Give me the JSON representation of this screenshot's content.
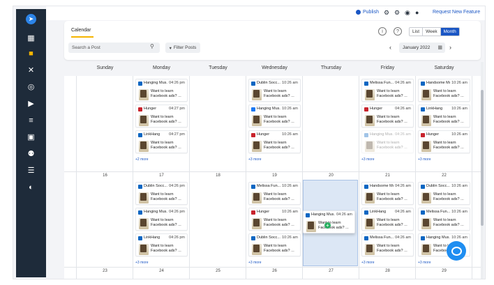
{
  "colors": {
    "accent": "#1a56c4",
    "sidebar_bg": "#1e2b3a",
    "tab_underline": "#f5b400",
    "drop_target": "#dce7f5",
    "add_indicator": "#27ae60"
  },
  "sidebar": {
    "items": [
      {
        "icon": "send-logo-icon"
      },
      {
        "icon": "dashboard-icon"
      },
      {
        "icon": "chat-bubbles-icon"
      },
      {
        "icon": "tools-icon"
      },
      {
        "icon": "target-icon"
      },
      {
        "icon": "megaphone-icon"
      },
      {
        "icon": "analytics-icon"
      },
      {
        "icon": "inbox-icon"
      },
      {
        "icon": "team-icon"
      },
      {
        "icon": "document-icon"
      },
      {
        "icon": "headset-icon"
      }
    ]
  },
  "topbar": {
    "publish_label": "Publish",
    "request_label": "Request New Feature"
  },
  "header": {
    "tab_label": "Calendar",
    "search_placeholder": "Search a Post",
    "filter_label": "Filter Posts",
    "month_label": "January 2022",
    "views": [
      "List",
      "Week",
      "Month"
    ],
    "selected_view": "Month"
  },
  "calendar": {
    "weekdays": [
      "Sunday",
      "Monday",
      "Tuesday",
      "Wednesday",
      "Thursday",
      "Friday",
      "Saturday"
    ],
    "weeks": [
      {
        "days": [
          {
            "num": "",
            "posts": [],
            "more": ""
          },
          {
            "num": "",
            "posts": [
              {
                "network": "linkedin",
                "account": "Hanging Mus...",
                "time": "04:26 pm",
                "line1": "Want to learn",
                "line2": "Facebook ads? ..."
              },
              {
                "network": "pinterest",
                "account": "Hunger",
                "time": "04:27 pm",
                "line1": "Want to learn",
                "line2": "Facebook ads? ..."
              },
              {
                "network": "linkedin",
                "account": "LinkHang",
                "time": "04:27 pm",
                "line1": "Want to learn",
                "line2": "Facebook ads? ..."
              }
            ],
            "more": "+2 more"
          },
          {
            "num": "",
            "posts": [],
            "more": ""
          },
          {
            "num": "",
            "posts": [
              {
                "network": "linkedin",
                "account": "Dublin Socc...",
                "time": "10:26 am",
                "line1": "Want to learn",
                "line2": "Facebook ads? ..."
              },
              {
                "network": "facebook",
                "account": "Hanging Mus...",
                "time": "10:26 am",
                "line1": "Want to learn",
                "line2": "Facebook ads? ..."
              },
              {
                "network": "pinterest",
                "account": "Hunger",
                "time": "10:26 am",
                "line1": "Want to learn",
                "line2": "Facebook ads? ..."
              }
            ],
            "more": "+3 more"
          },
          {
            "num": "",
            "posts": [],
            "more": ""
          },
          {
            "num": "",
            "posts": [
              {
                "network": "linkedin",
                "account": "Melissa Fun...",
                "time": "04:26 am",
                "line1": "Want to learn",
                "line2": "Facebook ads? ..."
              },
              {
                "network": "pinterest",
                "account": "Hunger",
                "time": "04:26 am",
                "line1": "Want to learn",
                "line2": "Facebook ads? ..."
              },
              {
                "network": "linkedin",
                "account": "Hanging Mus...",
                "time": "04:26 am",
                "line1": "Want to learn",
                "line2": "Facebook ads? ...",
                "faded": true
              }
            ],
            "more": "+3 more"
          },
          {
            "num": "",
            "posts": [
              {
                "network": "linkedin",
                "account": "Handsome Mu...",
                "time": "10:26 am",
                "line1": "Want to learn",
                "line2": "Facebook ads? ..."
              },
              {
                "network": "linkedin",
                "account": "LinkHang",
                "time": "10:26 am",
                "line1": "Want to learn",
                "line2": "Facebook ads? ..."
              },
              {
                "network": "pinterest",
                "account": "Hunger",
                "time": "10:26 am",
                "line1": "Want to learn",
                "line2": "Facebook ads? ..."
              }
            ],
            "more": "+3 more"
          }
        ]
      },
      {
        "days": [
          {
            "num": "16",
            "posts": [],
            "more": ""
          },
          {
            "num": "17",
            "posts": [
              {
                "network": "linkedin",
                "account": "Dublin Socc...",
                "time": "04:26 pm",
                "line1": "Want to learn",
                "line2": "Facebook ads? ..."
              },
              {
                "network": "linkedin",
                "account": "Hanging Mus...",
                "time": "04:26 pm",
                "line1": "Want to learn",
                "line2": "Facebook ads? ..."
              },
              {
                "network": "linkedin",
                "account": "LinkHang",
                "time": "04:26 pm",
                "line1": "Want to learn",
                "line2": "Facebook ads? ..."
              }
            ],
            "more": "+3 more"
          },
          {
            "num": "18",
            "posts": [],
            "more": ""
          },
          {
            "num": "19",
            "posts": [
              {
                "network": "linkedin",
                "account": "Melissa Fun...",
                "time": "10:26 am",
                "line1": "Want to learn",
                "line2": "Facebook ads? ..."
              },
              {
                "network": "pinterest",
                "account": "Hunger",
                "time": "10:26 am",
                "line1": "Want to learn",
                "line2": "Facebook ads? ..."
              },
              {
                "network": "linkedin",
                "account": "Dublin Socc...",
                "time": "10:26 am",
                "line1": "Want to learn",
                "line2": "Facebook ads? ..."
              }
            ],
            "more": "+3 more"
          },
          {
            "num": "20",
            "posts": [],
            "more": ""
          },
          {
            "num": "21",
            "posts": [
              {
                "network": "linkedin",
                "account": "Handsome Mu...",
                "time": "04:26 am",
                "line1": "Want to learn",
                "line2": "Facebook ads? ..."
              },
              {
                "network": "linkedin",
                "account": "LinkHang",
                "time": "04:26 am",
                "line1": "Want to learn",
                "line2": "Facebook ads? ..."
              },
              {
                "network": "linkedin",
                "account": "Melissa Fun...",
                "time": "04:26 am",
                "line1": "Want to learn",
                "line2": "Facebook ads? ..."
              }
            ],
            "more": "+3 more"
          },
          {
            "num": "22",
            "posts": [
              {
                "network": "linkedin",
                "account": "Dublin Socc...",
                "time": "10:26 am",
                "line1": "Want to learn",
                "line2": "Facebook ads? ..."
              },
              {
                "network": "linkedin",
                "account": "Melissa Fun...",
                "time": "10:26 am",
                "line1": "Want to learn",
                "line2": "Facebook ads? ..."
              },
              {
                "network": "linkedin",
                "account": "Hanging Mus...",
                "time": "10:26 am",
                "line1": "Want to learn",
                "line2": "Facebook ads? ..."
              }
            ],
            "more": "+3 more"
          }
        ]
      },
      {
        "days": [
          {
            "num": "23"
          },
          {
            "num": "24"
          },
          {
            "num": "25"
          },
          {
            "num": "26"
          },
          {
            "num": "27"
          },
          {
            "num": "28"
          },
          {
            "num": "29"
          }
        ]
      }
    ],
    "dragging": {
      "account": "Hanging Mus...",
      "time": "04:26 am",
      "line1": "Want to learn",
      "line2": "Facebook ads? ...",
      "network": "linkedin",
      "action_symbol": "+"
    }
  }
}
